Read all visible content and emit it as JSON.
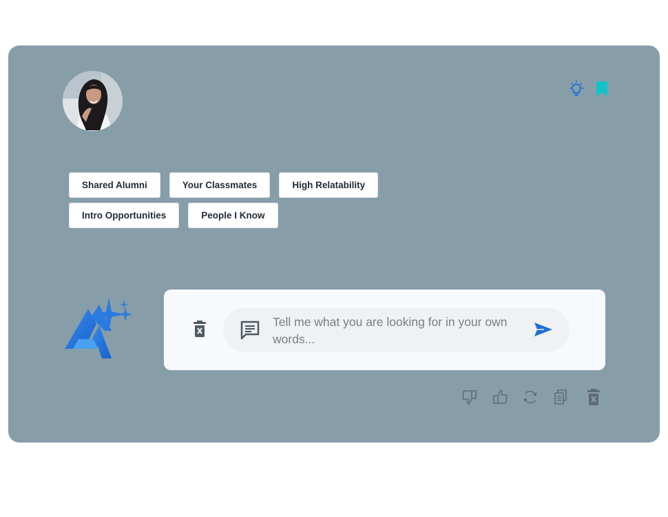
{
  "profile": {
    "avatar_icon": "profile-photo"
  },
  "header": {
    "icons": [
      "lightbulb-icon",
      "bookmark-icon"
    ]
  },
  "filters": {
    "chips": [
      {
        "label": "Shared Alumni"
      },
      {
        "label": "Your Classmates"
      },
      {
        "label": "High Relatability"
      },
      {
        "label": "Intro Opportunities"
      },
      {
        "label": "People I Know"
      }
    ]
  },
  "chat": {
    "placeholder": "Tell me what you are looking for in your own words...",
    "icons": [
      "trash-icon",
      "message-icon",
      "send-icon"
    ]
  },
  "actions": {
    "icons": [
      "thumbs-down-icon",
      "thumbs-up-icon",
      "refresh-icon",
      "copy-icon",
      "trash-icon"
    ]
  },
  "colors": {
    "card_background": "#879ea9",
    "accent_blue": "#1f6fd8",
    "bookmark_teal": "#12c4c8",
    "chip_text": "#1f2a37",
    "icon_gray": "#5e6b75"
  }
}
